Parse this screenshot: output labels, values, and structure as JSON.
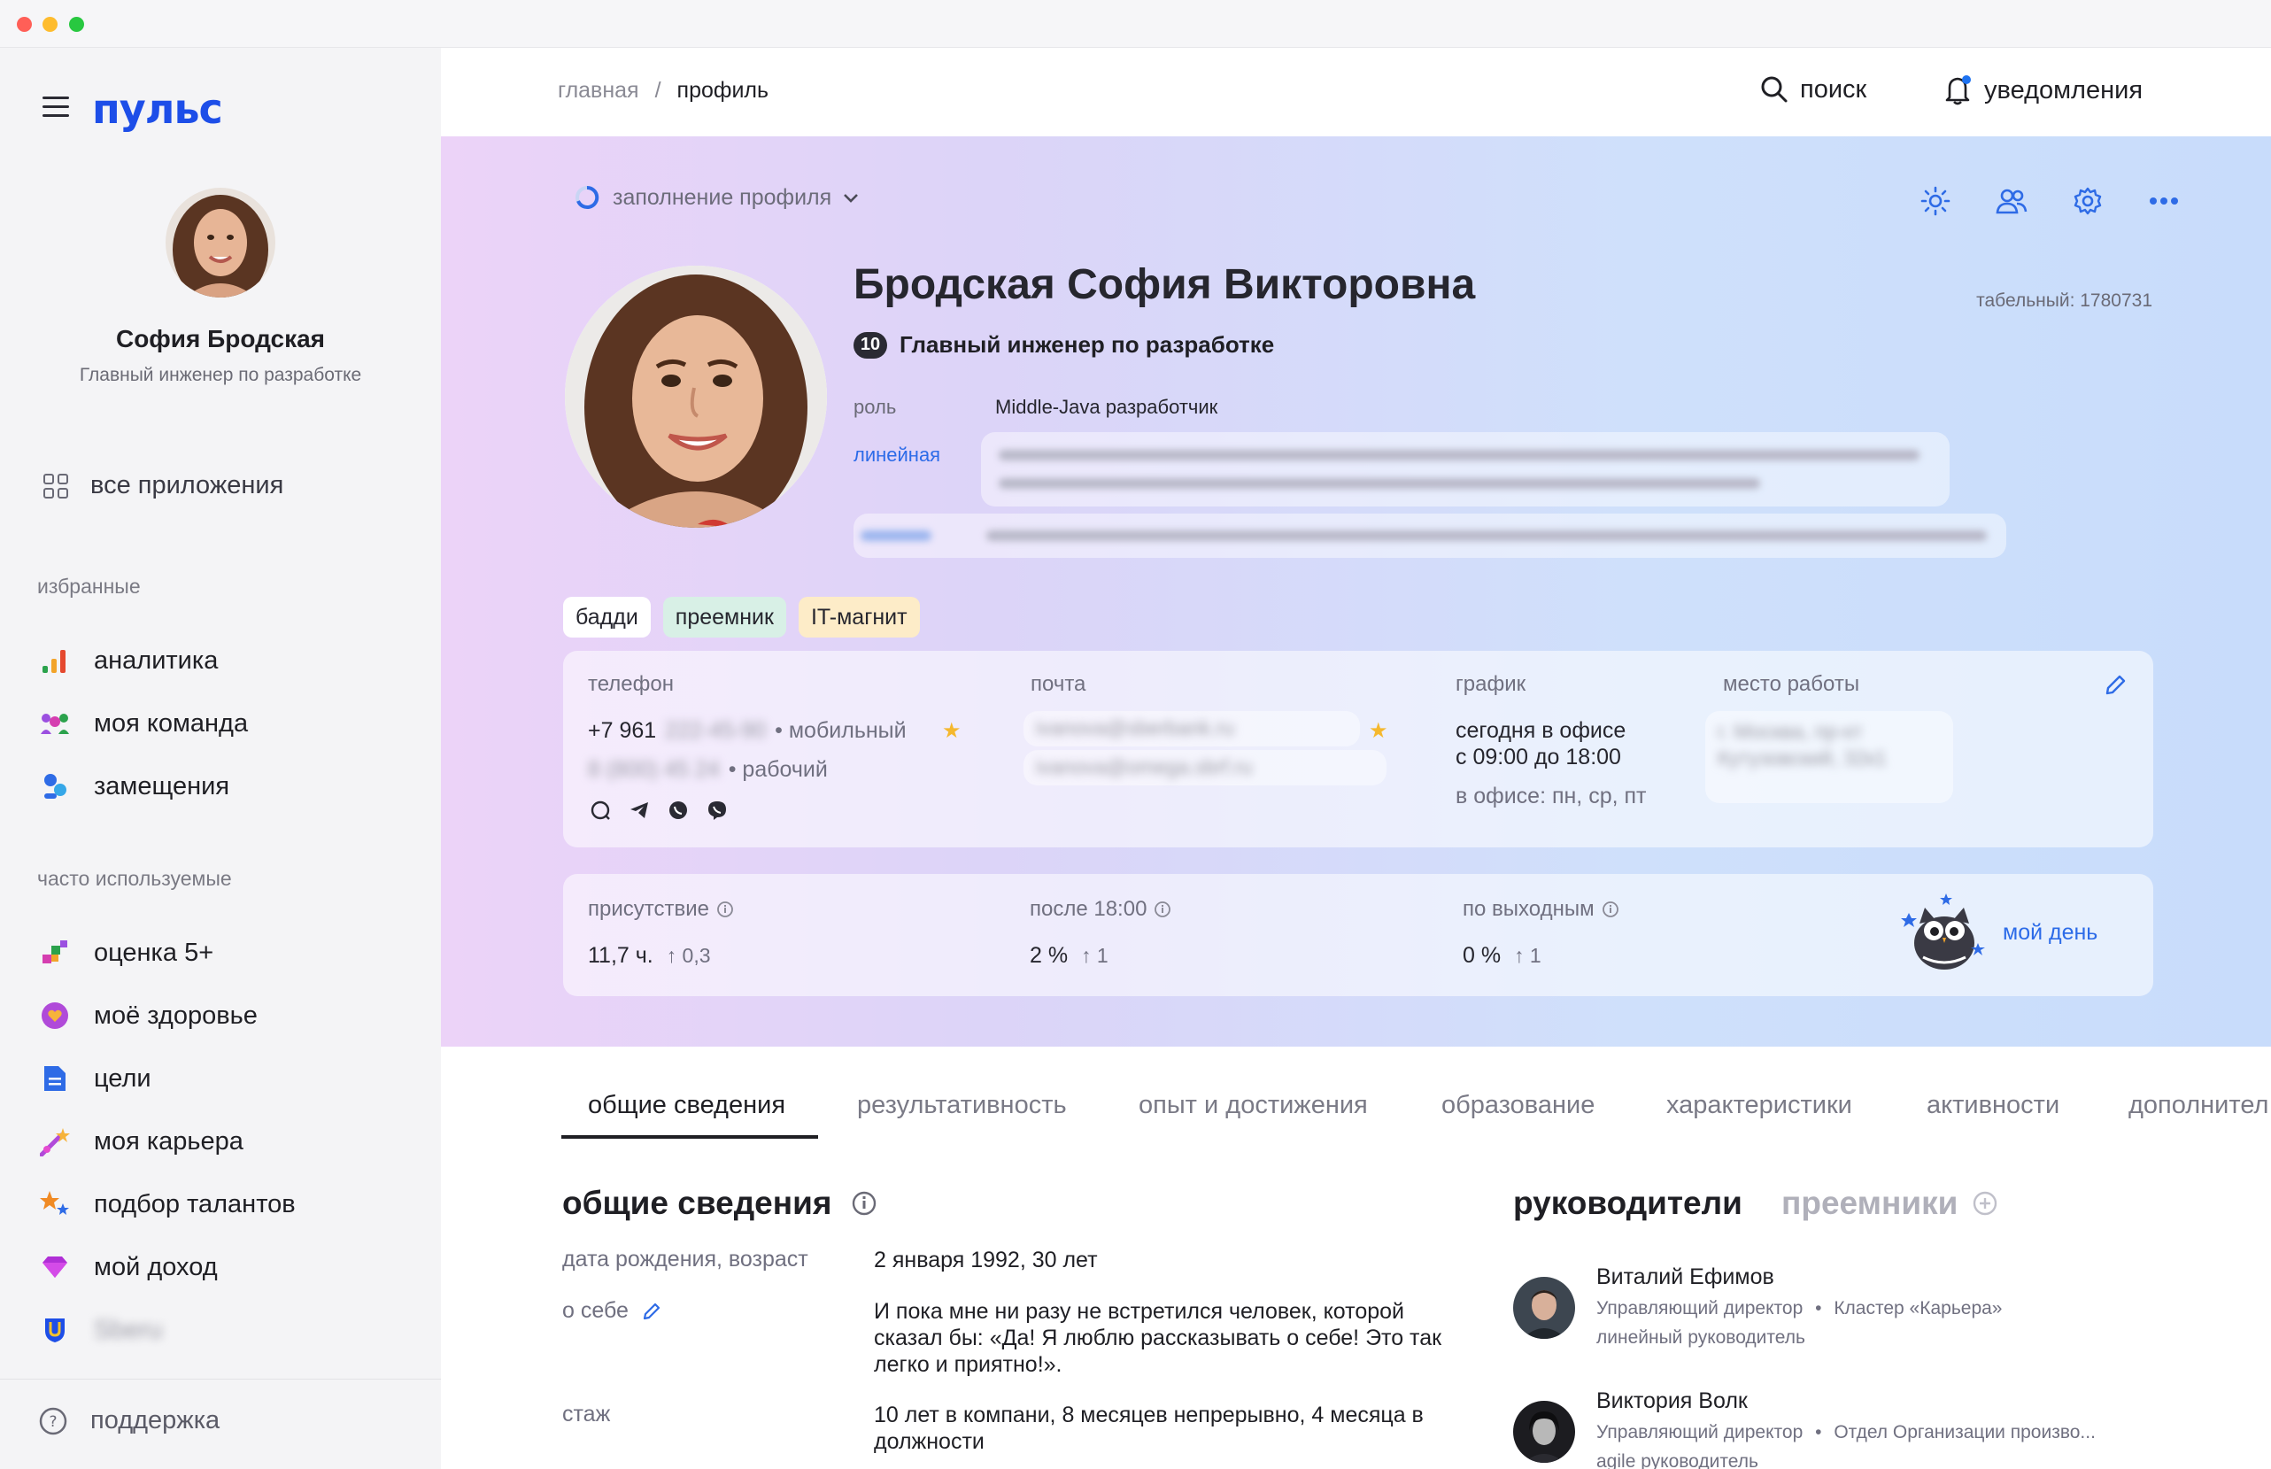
{
  "app": {
    "logo": "пульс"
  },
  "sidebar": {
    "user_name": "София Бродская",
    "user_role": "Главный инженер по разработке",
    "all_apps": "все приложения",
    "favorites_title": "избранные",
    "favorites": [
      {
        "label": "аналитика",
        "icon": "analytics-icon"
      },
      {
        "label": "моя команда",
        "icon": "team-icon"
      },
      {
        "label": "замещения",
        "icon": "substitution-icon"
      }
    ],
    "frequent_title": "часто используемые",
    "frequent": [
      {
        "label": "оценка 5+",
        "icon": "rating-icon"
      },
      {
        "label": "моё здоровье",
        "icon": "health-icon"
      },
      {
        "label": "цели",
        "icon": "goals-icon"
      },
      {
        "label": "моя карьера",
        "icon": "career-icon"
      },
      {
        "label": "подбор талантов",
        "icon": "talent-icon"
      },
      {
        "label": "мой доход",
        "icon": "income-icon"
      },
      {
        "label": "Sberu",
        "icon": "shield-icon"
      }
    ],
    "support": "поддержка"
  },
  "header": {
    "breadcrumb": [
      "главная",
      "профиль"
    ],
    "search": "поиск",
    "notifications": "уведомления"
  },
  "profile": {
    "fill_label": "заполнение профиля",
    "full_name": "Бродская София Викторовна",
    "personnel_no": "табельный: 1780731",
    "grade": "10",
    "position": "Главный инженер по разработке",
    "role_label": "роль",
    "role_value": "Middle-Java разработчик",
    "line_label": "линейная",
    "tags": [
      "бадди",
      "преемник",
      "IT-магнит"
    ],
    "contacts": {
      "phone_label": "телефон",
      "phone_mobile": "+7 961",
      "phone_mobile_hidden": "222-45-90",
      "phone_mobile_type": "• мобильный",
      "phone_work_hidden": "8 (800) 45 24",
      "phone_work_type": "• рабочий",
      "email_label": "почта",
      "email_1": "ivanova@sberbank.ru",
      "email_2": "ivanova@omega.sbrf.ru",
      "schedule_label": "график",
      "schedule_today": "сегодня в офисе",
      "schedule_hours": "с 09:00 до 18:00",
      "schedule_days": "в офисе: пн, ср, пт",
      "workplace_label": "место работы",
      "workplace_value": "г. Москва, пр-кт Кутузовский, 32к1"
    },
    "stats": [
      {
        "label": "присутствие",
        "value": "11,7 ч.",
        "delta": "↑ 0,3"
      },
      {
        "label": "после 18:00",
        "value": "2 %",
        "delta": "↑ 1"
      },
      {
        "label": "по выходным",
        "value": "0 %",
        "delta": "↑ 1"
      }
    ],
    "my_day": "мой день"
  },
  "tabs": [
    "общие сведения",
    "результативность",
    "опыт и достижения",
    "образование",
    "характеристики",
    "активности",
    "дополнител"
  ],
  "general": {
    "title": "общие сведения",
    "rows": [
      {
        "label": "дата рождения, возраст",
        "value": "2 января 1992, 30 лет"
      },
      {
        "label": "о себе",
        "value": "И пока мне ни разу не встретился человек, которой сказал бы: «Да! Я люблю рассказывать о себе! Это так легко и приятно!»."
      },
      {
        "label": "стаж",
        "value": "10 лет в компани, 8 месяцев непрерывно, 4 месяца в должности"
      }
    ]
  },
  "managers": {
    "title": "руководители",
    "successors_tab": "преемники",
    "items": [
      {
        "name": "Виталий Ефимов",
        "title": "Управляющий директор",
        "unit": "Кластер «Карьера»",
        "relation": "линейный руководитель"
      },
      {
        "name": "Виктория Волк",
        "title": "Управляющий директор",
        "unit": "Отдел Организации произво...",
        "relation": "agile руководитель"
      }
    ]
  },
  "colors": {
    "accent": "#1d4ee8",
    "star": "#f5b82e",
    "tag_buddy": "#ffffff",
    "tag_successor": "#d8f0e6",
    "tag_magnet": "#fdecc8"
  }
}
